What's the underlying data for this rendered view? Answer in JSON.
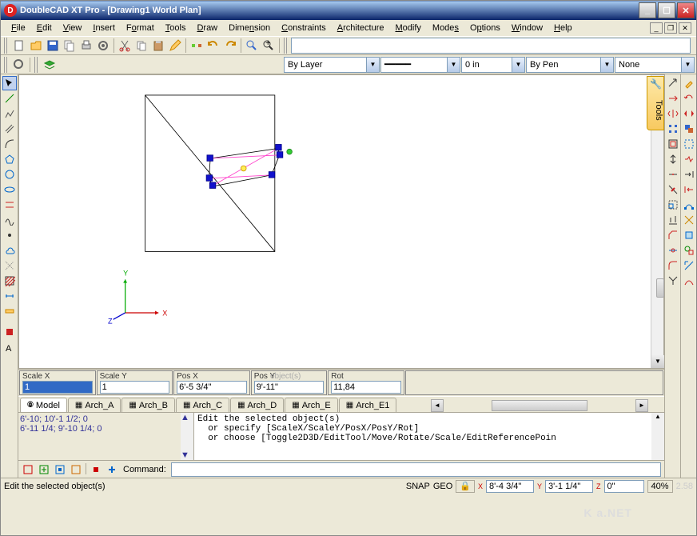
{
  "title": "DoubleCAD XT Pro - [Drawing1 World Plan]",
  "menus": [
    "File",
    "Edit",
    "View",
    "Insert",
    "Format",
    "Tools",
    "Draw",
    "Dimension",
    "Constraints",
    "Architecture",
    "Modify",
    "Modes",
    "Options",
    "Window",
    "Help"
  ],
  "props": {
    "layer": "By Layer",
    "lwidth": "0 in",
    "pen": "By Pen",
    "style": "None"
  },
  "tools_tab": "Tools",
  "inputs": {
    "scalex_label": "Scale X",
    "scalex": "1",
    "scaley_label": "Scale Y",
    "scaley": "1",
    "posx_label": "Pos X",
    "posx": "6'-5 3/4\"",
    "posy_label": "Pos Y",
    "posy": "9'-11\"",
    "rot_label": "Rot",
    "rot": "11,84",
    "hint": "object(s)"
  },
  "tabs": [
    "Model",
    "Arch_A",
    "Arch_B",
    "Arch_C",
    "Arch_D",
    "Arch_E",
    "Arch_E1"
  ],
  "history": [
    "6'-10; 10'-1 1/2; 0",
    "6'-11 1/4; 9'-10 1/4; 0"
  ],
  "cmdtext": "Edit the selected object(s)\n  or specify [ScaleX/ScaleY/PosX/PosY/Rot]\n  or choose [Toggle2D3D/EditTool/Move/Rotate/Scale/EditReferencePoin",
  "cmdlabel": "Command:",
  "status": {
    "hint": "Edit the selected object(s)",
    "snap": "SNAP",
    "geo": "GEO",
    "x": "8'-4 3/4\"",
    "y": "3'-1 1/4\"",
    "z": "0\"",
    "zoom": "40%",
    "extra": "2.58"
  },
  "axis": {
    "x": "X",
    "y": "Y",
    "z": "Z"
  },
  "watermark": "K   a.NET"
}
